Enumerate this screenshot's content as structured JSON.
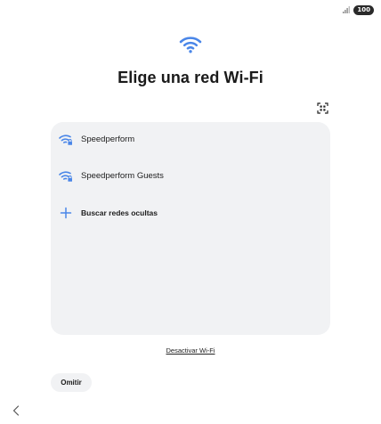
{
  "status_bar": {
    "signal_icon": "signal-bars-icon",
    "battery_level": "100"
  },
  "header": {
    "icon": "wifi-icon",
    "title": "Elige una red Wi-Fi",
    "qr_icon": "qr-scan-icon"
  },
  "networks": {
    "items": [
      {
        "label": "Speedperform",
        "icon": "wifi-locked-icon"
      },
      {
        "label": "Speedperform Guests",
        "icon": "wifi-locked-icon"
      },
      {
        "label": "Buscar redes ocultas",
        "icon": "plus-icon"
      }
    ]
  },
  "footer": {
    "deactivate_label": "Desactivar Wi-Fi",
    "skip_label": "Omitir",
    "back_icon": "chevron-left-icon"
  },
  "colors": {
    "accent": "#4a86e8",
    "card_bg": "#f1f2f4"
  }
}
